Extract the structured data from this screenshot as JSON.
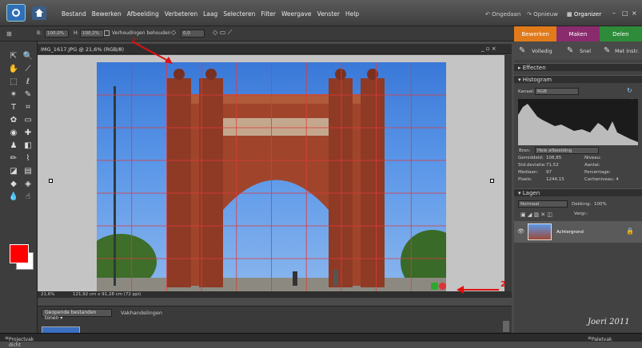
{
  "menubar": {
    "items": [
      "Bestand",
      "Bewerken",
      "Afbeelding",
      "Verbeteren",
      "Laag",
      "Selecteren",
      "Filter",
      "Weergave",
      "Venster",
      "Help"
    ],
    "undo": "Ongedaan",
    "redo": "Opnieuw",
    "organizer": "Organizer"
  },
  "options": {
    "b_label": "B:",
    "b_value": "100,0%",
    "h_label": "H:",
    "h_value": "100,2%",
    "keep_ratio": "Verhoudingen behouden",
    "angle": "0,0"
  },
  "tabs": [
    "Bewerken",
    "Maken",
    "Delen"
  ],
  "tab_colors": [
    "#e07a1a",
    "#8a2b6e",
    "#2e8b3a"
  ],
  "subtabs": {
    "full": "Volledig",
    "quick": "Snel",
    "guided": "Met instr."
  },
  "document": {
    "title": "IMG_1617.JPG @ 21,6% (RGB/8)",
    "zoom": "21,6%",
    "dimensions": "121,92 cm x 91,28 cm (72 ppi)"
  },
  "annotations": {
    "one": "1",
    "two": "2"
  },
  "panels": {
    "effects": "Effecten",
    "histogram": "Histogram",
    "channel_label": "Kanaal:",
    "channel_value": "RGB",
    "source_label": "Bron:",
    "source_value": "Hele afbeelding",
    "stats_left": [
      [
        "Gemiddeld:",
        "108,85"
      ],
      [
        "Std.deviatie:",
        "71,52"
      ],
      [
        "Mediaan:",
        "97"
      ],
      [
        "Pixels:",
        "1244,15"
      ]
    ],
    "stats_right": [
      "Niveau:",
      "Aantal:",
      "Percentage:",
      "Cacheniveau: 4"
    ],
    "layers": "Lagen",
    "blend_mode": "Normaal",
    "opacity_label": "Dekking:",
    "opacity_value": "100%",
    "lock_label": "Vergr.:",
    "layer_name": "Achtergrond"
  },
  "bin": {
    "dropdown": "Geopende bestanden tonen",
    "label": "Vakhandelingen"
  },
  "bottom": {
    "left": "Projectvak dicht",
    "right": "Paletvak"
  },
  "signature": "Joeri 2011"
}
